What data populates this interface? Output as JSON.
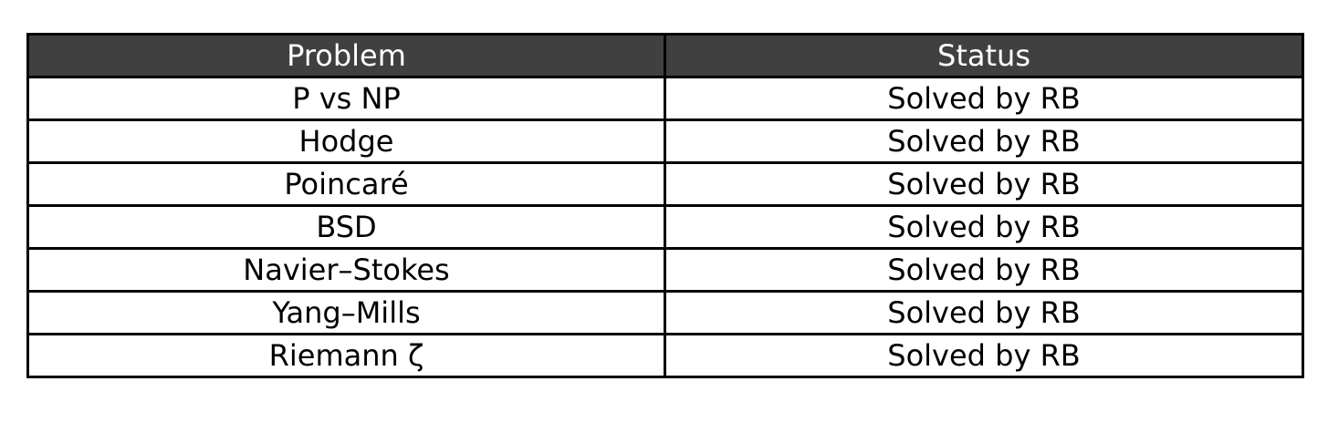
{
  "chart_data": {
    "type": "table",
    "columns": [
      "Problem",
      "Status"
    ],
    "rows": [
      [
        "P vs NP",
        "Solved by RB"
      ],
      [
        "Hodge",
        "Solved by RB"
      ],
      [
        "Poincaré",
        "Solved by RB"
      ],
      [
        "BSD",
        "Solved by RB"
      ],
      [
        "Navier–Stokes",
        "Solved by RB"
      ],
      [
        "Yang–Mills",
        "Solved by RB"
      ],
      [
        "Riemann ζ",
        "Solved by RB"
      ]
    ],
    "header_bg": "#404040",
    "header_fg": "#ffffff",
    "border_color": "#000000"
  }
}
